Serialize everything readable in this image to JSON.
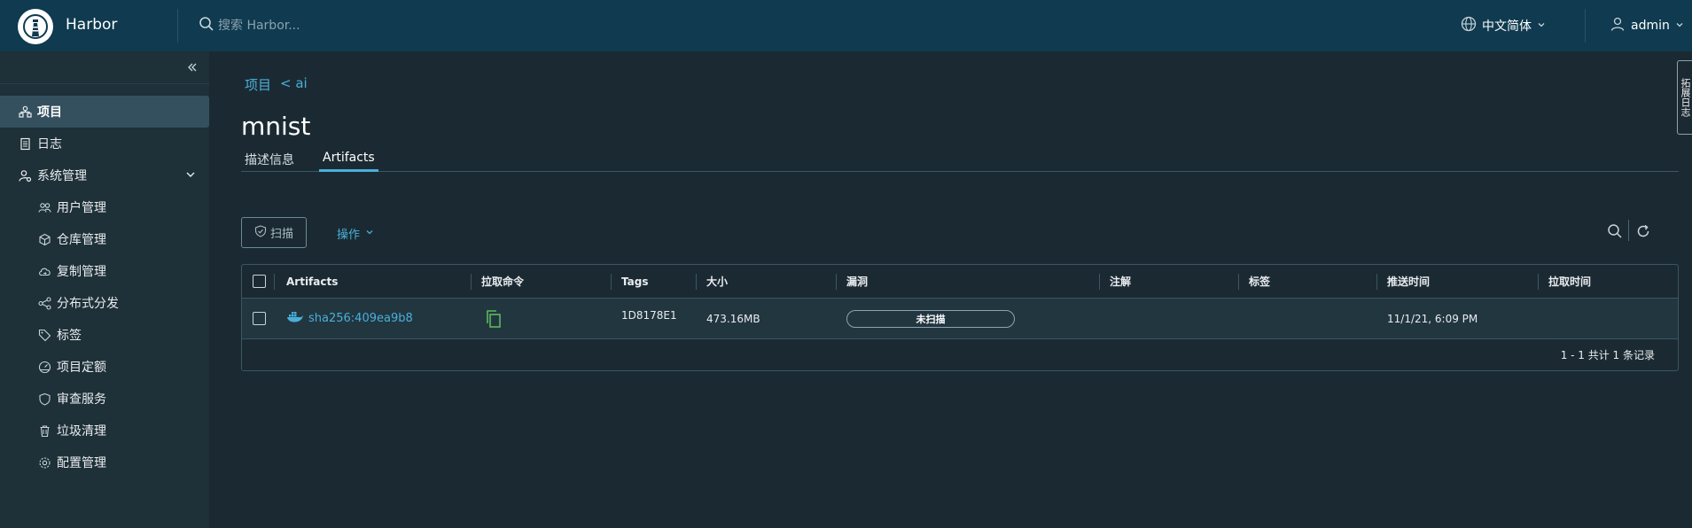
{
  "header": {
    "brand": "Harbor",
    "search_placeholder": "搜索 Harbor...",
    "language": "中文简体",
    "user": "admin"
  },
  "sidebar": {
    "items": [
      {
        "label": "项目",
        "icon": "projects-icon",
        "active": true
      },
      {
        "label": "日志",
        "icon": "log-icon"
      },
      {
        "label": "系统管理",
        "icon": "admin-icon",
        "expandable": true
      },
      {
        "label": "用户管理",
        "icon": "users-icon",
        "sub": true
      },
      {
        "label": "仓库管理",
        "icon": "registry-icon",
        "sub": true
      },
      {
        "label": "复制管理",
        "icon": "replication-icon",
        "sub": true
      },
      {
        "label": "分布式分发",
        "icon": "distribution-icon",
        "sub": true
      },
      {
        "label": "标签",
        "icon": "tag-icon",
        "sub": true
      },
      {
        "label": "项目定额",
        "icon": "quota-icon",
        "sub": true
      },
      {
        "label": "审查服务",
        "icon": "interrogation-icon",
        "sub": true
      },
      {
        "label": "垃圾清理",
        "icon": "trash-icon",
        "sub": true
      },
      {
        "label": "配置管理",
        "icon": "gear-icon",
        "sub": true
      }
    ]
  },
  "breadcrumb": {
    "root": "项目",
    "current": "< ai"
  },
  "page": {
    "title": "mnist"
  },
  "tabs": [
    {
      "label": "描述信息",
      "active": false
    },
    {
      "label": "Artifacts",
      "active": true
    }
  ],
  "toolbar": {
    "scan_label": "扫描",
    "actions_label": "操作"
  },
  "table": {
    "columns": [
      "Artifacts",
      "拉取命令",
      "Tags",
      "大小",
      "漏洞",
      "注解",
      "标签",
      "推送时间",
      "拉取时间"
    ],
    "rows": [
      {
        "artifact": "sha256:409ea9b8",
        "tags": "1D8178E1",
        "size": "473.16MB",
        "vulnerability": "未扫描",
        "annotations": "",
        "labels": "",
        "push_time": "11/1/21, 6:09 PM",
        "pull_time": ""
      }
    ],
    "footer": "1 - 1 共计 1 条记录"
  },
  "side_tab": "拓展日志",
  "colors": {
    "header_bg": "#0f3a4f",
    "sidebar_bg": "#1e3038",
    "content_bg": "#1b2a32",
    "accent": "#49afd9",
    "copy_icon": "#5cb85c"
  }
}
